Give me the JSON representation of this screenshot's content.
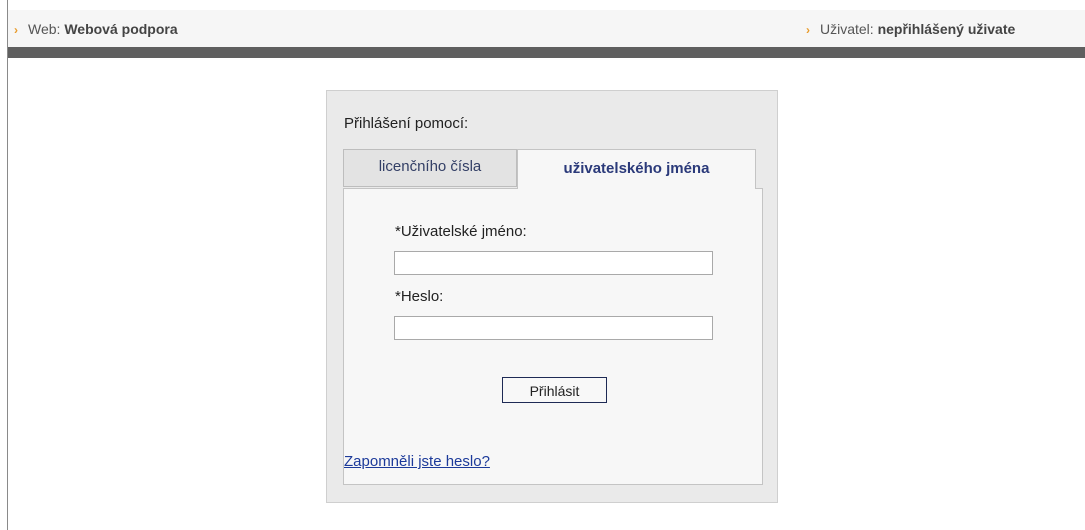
{
  "topbar": {
    "web_label": "Web:",
    "web_value": "Webová podpora",
    "user_label": "Uživatel:",
    "user_value": "nepřihlášený uživate"
  },
  "login": {
    "title": "Přihlášení pomocí:",
    "tabs": [
      {
        "label": "licenčního čísla"
      },
      {
        "label": "uživatelského jména"
      }
    ],
    "username_label": "*Uživatelské jméno:",
    "username_value": "",
    "password_label": "*Heslo:",
    "password_value": "",
    "submit_label": "Přihlásit",
    "forgot_link": "Zapomněli jste heslo?"
  },
  "colors": {
    "accent_arrow": "#e89c2c",
    "dark_bar": "#5f5f5f",
    "link": "#1c3a9a"
  }
}
